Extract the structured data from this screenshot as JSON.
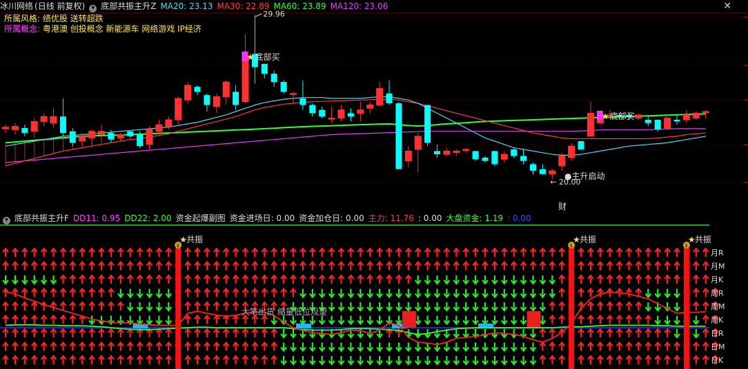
{
  "main_header": {
    "stock": "冰川网络",
    "period": "(日线 前复权)",
    "indicator": "底部共振主升Z",
    "ma": [
      {
        "label": "MA20: 23.13",
        "color": "#4fd7ee"
      },
      {
        "label": "MA30: 22.89",
        "color": "#ff3b3b"
      },
      {
        "label": "MA60: 23.89",
        "color": "#33ff33"
      },
      {
        "label": "MA120: 23.06",
        "color": "#e040ff"
      }
    ]
  },
  "info": {
    "style_label": "所属风格:",
    "style_value": "绩优股 送转超跌",
    "concept_label": "所属概念:",
    "concept_value": "粤港澳 创投概念 新能源车 网络游戏 IP经济"
  },
  "annotations": {
    "high": "29.96",
    "low": "20.00",
    "buy_label": "底部买",
    "launch_label": "●主升启动",
    "fin_label": "财",
    "resonance_label": "共振",
    "warning": "大笔出货 缩量低位观望"
  },
  "ind_header": {
    "indicator": "底部共振主升F",
    "items": [
      {
        "label": "DD11: 0.95",
        "color": "#ff40ff"
      },
      {
        "label": "DD22: 2.00",
        "color": "#33ff33"
      },
      {
        "label": "资金起爆副图",
        "color": "#dddddd"
      },
      {
        "label": "资金进场日: 0.00",
        "color": "#dddddd"
      },
      {
        "label": "资金加仓日: 0.00",
        "color": "#dddddd"
      },
      {
        "label": "主力: 11.76",
        "color": "#ff3b3b"
      },
      {
        "label": ": 0.00",
        "color": "#dddddd"
      },
      {
        "label": "大盘资金: 1.19",
        "color": "#33ff33"
      },
      {
        "label": ": 0.00",
        "color": "#3333ff"
      }
    ]
  },
  "row_labels": [
    "月R",
    "月M",
    "月K",
    "周R",
    "周M",
    "周K",
    "日R",
    "日M",
    "日K"
  ],
  "colors": {
    "up": "#ff3030",
    "down": "#00ffff",
    "ma20": "#4fd7ee",
    "ma30": "#ff3b3b",
    "ma60": "#33ff33",
    "ma120": "#e040ff",
    "arrow_up": "#ff2020",
    "arrow_down": "#22ee22"
  },
  "chart_data": {
    "type": "candlestick",
    "candles": [
      {
        "o": 23.05,
        "h": 23.3,
        "l": 22.8,
        "c": 23.15
      },
      {
        "o": 23.0,
        "h": 23.4,
        "l": 22.7,
        "c": 23.2
      },
      {
        "o": 23.1,
        "h": 23.3,
        "l": 22.6,
        "c": 22.8
      },
      {
        "o": 22.9,
        "h": 23.7,
        "l": 22.5,
        "c": 23.5
      },
      {
        "o": 23.5,
        "h": 24.0,
        "l": 23.2,
        "c": 23.8
      },
      {
        "o": 23.4,
        "h": 24.3,
        "l": 23.1,
        "c": 23.8
      },
      {
        "o": 23.8,
        "h": 24.9,
        "l": 22.6,
        "c": 22.8
      },
      {
        "o": 22.9,
        "h": 23.1,
        "l": 22.0,
        "c": 22.2
      },
      {
        "o": 22.3,
        "h": 22.8,
        "l": 22.0,
        "c": 22.6
      },
      {
        "o": 22.5,
        "h": 23.0,
        "l": 22.1,
        "c": 22.9
      },
      {
        "o": 22.7,
        "h": 23.3,
        "l": 22.3,
        "c": 22.9
      },
      {
        "o": 22.8,
        "h": 23.0,
        "l": 22.2,
        "c": 22.4
      },
      {
        "o": 22.5,
        "h": 22.8,
        "l": 22.3,
        "c": 22.7
      },
      {
        "o": 22.9,
        "h": 22.9,
        "l": 22.5,
        "c": 22.6
      },
      {
        "o": 22.7,
        "h": 22.9,
        "l": 21.9,
        "c": 22.0
      },
      {
        "o": 22.1,
        "h": 23.2,
        "l": 21.8,
        "c": 23.0
      },
      {
        "o": 22.9,
        "h": 23.6,
        "l": 22.7,
        "c": 23.3
      },
      {
        "o": 23.2,
        "h": 23.8,
        "l": 23.0,
        "c": 23.6
      },
      {
        "o": 23.6,
        "h": 25.0,
        "l": 23.3,
        "c": 24.9
      },
      {
        "o": 24.8,
        "h": 25.9,
        "l": 24.6,
        "c": 25.7
      },
      {
        "o": 25.6,
        "h": 25.7,
        "l": 25.1,
        "c": 25.3
      },
      {
        "o": 25.1,
        "h": 25.2,
        "l": 24.1,
        "c": 24.5
      },
      {
        "o": 24.4,
        "h": 25.2,
        "l": 24.0,
        "c": 25.0
      },
      {
        "o": 25.0,
        "h": 26.0,
        "l": 24.5,
        "c": 25.9
      },
      {
        "o": 25.3,
        "h": 25.7,
        "l": 24.2,
        "c": 24.5
      },
      {
        "o": 24.7,
        "h": 28.8,
        "l": 24.6,
        "c": 27.5
      },
      {
        "o": 27.6,
        "h": 29.96,
        "l": 25.8,
        "c": 26.8
      },
      {
        "o": 27.0,
        "h": 27.0,
        "l": 26.1,
        "c": 26.4
      },
      {
        "o": 26.4,
        "h": 26.6,
        "l": 25.6,
        "c": 25.9
      },
      {
        "o": 25.9,
        "h": 26.0,
        "l": 25.2,
        "c": 25.3
      },
      {
        "o": 25.2,
        "h": 25.3,
        "l": 24.6,
        "c": 25.2
      },
      {
        "o": 24.9,
        "h": 26.0,
        "l": 24.2,
        "c": 24.5
      },
      {
        "o": 24.5,
        "h": 24.6,
        "l": 23.8,
        "c": 24.0
      },
      {
        "o": 24.2,
        "h": 24.4,
        "l": 23.7,
        "c": 23.8
      },
      {
        "o": 23.7,
        "h": 24.4,
        "l": 23.4,
        "c": 23.7
      },
      {
        "o": 23.7,
        "h": 24.5,
        "l": 23.5,
        "c": 24.2
      },
      {
        "o": 24.0,
        "h": 24.3,
        "l": 23.5,
        "c": 23.8
      },
      {
        "o": 24.0,
        "h": 24.7,
        "l": 23.5,
        "c": 24.2
      },
      {
        "o": 24.3,
        "h": 24.7,
        "l": 24.0,
        "c": 24.5
      },
      {
        "o": 24.5,
        "h": 25.9,
        "l": 24.4,
        "c": 25.5
      },
      {
        "o": 25.2,
        "h": 26.0,
        "l": 24.5,
        "c": 24.6
      },
      {
        "o": 24.6,
        "h": 24.7,
        "l": 20.6,
        "c": 20.6
      },
      {
        "o": 21.1,
        "h": 22.0,
        "l": 20.7,
        "c": 21.7
      },
      {
        "o": 21.8,
        "h": 22.8,
        "l": 20.4,
        "c": 22.6
      },
      {
        "o": 24.5,
        "h": 24.5,
        "l": 22.0,
        "c": 22.2
      },
      {
        "o": 21.7,
        "h": 22.1,
        "l": 21.3,
        "c": 21.5
      },
      {
        "o": 21.5,
        "h": 21.9,
        "l": 21.4,
        "c": 21.7
      },
      {
        "o": 21.6,
        "h": 21.8,
        "l": 21.4,
        "c": 21.7
      },
      {
        "o": 21.8,
        "h": 21.9,
        "l": 21.6,
        "c": 21.8
      },
      {
        "o": 21.7,
        "h": 21.7,
        "l": 21.1,
        "c": 21.2
      },
      {
        "o": 21.3,
        "h": 21.4,
        "l": 21.0,
        "c": 21.1
      },
      {
        "o": 21.7,
        "h": 21.7,
        "l": 20.8,
        "c": 20.9
      },
      {
        "o": 21.2,
        "h": 21.7,
        "l": 21.0,
        "c": 21.5
      },
      {
        "o": 21.8,
        "h": 21.9,
        "l": 21.3,
        "c": 21.4
      },
      {
        "o": 21.4,
        "h": 21.8,
        "l": 20.9,
        "c": 21.1
      },
      {
        "o": 20.9,
        "h": 21.0,
        "l": 20.3,
        "c": 20.5
      },
      {
        "o": 20.6,
        "h": 20.9,
        "l": 20.3,
        "c": 20.3
      },
      {
        "o": 20.3,
        "h": 20.6,
        "l": 20.0,
        "c": 20.5
      },
      {
        "o": 20.8,
        "h": 21.6,
        "l": 20.5,
        "c": 21.4
      },
      {
        "o": 21.3,
        "h": 22.2,
        "l": 21.1,
        "c": 22.0
      },
      {
        "o": 22.3,
        "h": 22.3,
        "l": 21.8,
        "c": 21.8
      },
      {
        "o": 22.6,
        "h": 24.7,
        "l": 22.6,
        "c": 24.0
      },
      {
        "o": 23.4,
        "h": 24.1,
        "l": 23.3,
        "c": 23.9
      },
      {
        "o": 23.9,
        "h": 24.2,
        "l": 23.7,
        "c": 23.9
      },
      {
        "o": 23.9,
        "h": 24.0,
        "l": 23.7,
        "c": 23.8
      },
      {
        "o": 23.9,
        "h": 24.0,
        "l": 23.6,
        "c": 23.8
      },
      {
        "o": 23.7,
        "h": 23.9,
        "l": 23.6,
        "c": 23.9
      },
      {
        "o": 23.6,
        "h": 23.8,
        "l": 23.2,
        "c": 23.4
      },
      {
        "o": 23.6,
        "h": 23.6,
        "l": 22.9,
        "c": 23.0
      },
      {
        "o": 23.1,
        "h": 23.9,
        "l": 23.0,
        "c": 23.7
      },
      {
        "o": 23.6,
        "h": 23.9,
        "l": 23.3,
        "c": 23.5
      },
      {
        "o": 23.6,
        "h": 24.2,
        "l": 23.4,
        "c": 23.9
      },
      {
        "o": 23.7,
        "h": 24.1,
        "l": 23.6,
        "c": 24.0
      },
      {
        "o": 24.1,
        "h": 24.2,
        "l": 23.7,
        "c": 24.1
      }
    ],
    "ma20": [
      22.0,
      22.1,
      22.2,
      22.3,
      22.4,
      22.5,
      22.6,
      22.65,
      22.7,
      22.75,
      22.8,
      22.85,
      22.9,
      22.95,
      23.0,
      23.05,
      23.1,
      23.15,
      23.25,
      23.35,
      23.45,
      23.6,
      23.75,
      23.9,
      24.1,
      24.3,
      24.5,
      24.65,
      24.75,
      24.85,
      24.9,
      24.95,
      24.95,
      24.95,
      24.9,
      24.9,
      24.9,
      24.9,
      24.95,
      25.0,
      25.0,
      24.9,
      24.8,
      24.6,
      24.3,
      24.0,
      23.7,
      23.4,
      23.1,
      22.8,
      22.5,
      22.3,
      22.1,
      21.9,
      21.8,
      21.7,
      21.6,
      21.5,
      21.45,
      21.45,
      21.5,
      21.6,
      21.7,
      21.8,
      21.9,
      22.0,
      22.05,
      22.1,
      22.15,
      22.2,
      22.3,
      22.4,
      22.5,
      22.6
    ],
    "ma30": [
      20.8,
      20.95,
      21.1,
      21.25,
      21.4,
      21.55,
      21.7,
      21.8,
      21.9,
      22.0,
      22.1,
      22.2,
      22.3,
      22.4,
      22.45,
      22.55,
      22.65,
      22.75,
      22.9,
      23.05,
      23.2,
      23.35,
      23.5,
      23.65,
      23.8,
      24.0,
      24.2,
      24.35,
      24.45,
      24.55,
      24.6,
      24.65,
      24.7,
      24.72,
      24.74,
      24.76,
      24.78,
      24.8,
      24.82,
      24.84,
      24.85,
      24.8,
      24.7,
      24.6,
      24.45,
      24.3,
      24.15,
      24.0,
      23.85,
      23.7,
      23.55,
      23.4,
      23.25,
      23.1,
      22.95,
      22.8,
      22.7,
      22.6,
      22.5,
      22.45,
      22.45,
      22.45,
      22.45,
      22.45,
      22.45,
      22.45,
      22.45,
      22.45,
      22.5,
      22.55,
      22.6,
      22.7,
      22.75,
      22.8
    ],
    "ma60": [
      22.2,
      22.25,
      22.3,
      22.35,
      22.4,
      22.45,
      22.5,
      22.55,
      22.6,
      22.62,
      22.64,
      22.66,
      22.68,
      22.7,
      22.72,
      22.75,
      22.78,
      22.8,
      22.82,
      22.85,
      22.88,
      22.9,
      22.93,
      22.95,
      22.98,
      23.0,
      23.03,
      23.06,
      23.09,
      23.12,
      23.15,
      23.18,
      23.2,
      23.22,
      23.24,
      23.26,
      23.28,
      23.3,
      23.32,
      23.34,
      23.35,
      23.3,
      23.25,
      23.22,
      23.25,
      23.3,
      23.35,
      23.38,
      23.42,
      23.46,
      23.5,
      23.52,
      23.54,
      23.56,
      23.58,
      23.6,
      23.62,
      23.64,
      23.66,
      23.68,
      23.7,
      23.72,
      23.74,
      23.76,
      23.78,
      23.8,
      23.82,
      23.84,
      23.86,
      23.88,
      23.9,
      23.92,
      23.94,
      23.96
    ],
    "ma120": [
      21.0,
      21.05,
      21.1,
      21.15,
      21.2,
      21.25,
      21.3,
      21.35,
      21.4,
      21.45,
      21.5,
      21.55,
      21.6,
      21.65,
      21.7,
      21.75,
      21.8,
      21.85,
      21.9,
      21.95,
      22.0,
      22.05,
      22.1,
      22.15,
      22.2,
      22.25,
      22.3,
      22.35,
      22.4,
      22.45,
      22.5,
      22.55,
      22.6,
      22.65,
      22.7,
      22.72,
      22.74,
      22.76,
      22.78,
      22.8,
      22.82,
      22.84,
      22.86,
      22.88,
      22.9,
      22.9,
      22.9,
      22.9,
      22.9,
      22.9,
      22.9,
      22.9,
      22.9,
      22.9,
      22.9,
      22.9,
      22.9,
      22.9,
      22.9,
      22.9,
      22.92,
      22.95,
      22.98,
      23.0,
      23.0,
      23.0,
      23.0,
      23.0,
      23.02,
      23.04,
      23.06,
      23.06,
      23.06,
      23.06
    ],
    "buy_signals": [
      25,
      62
    ],
    "resonance": [
      18,
      59,
      71
    ],
    "arrow_rows": [
      "UUUUUUUUUUUUUUUUUUUUUUUUUUUUUUUUUUUUUUUUUUUUUUUUUUUUUUUUUUUUUUUUUUUUUUUUUU",
      "UUUUUUUUUUUUUUUUUUUUUUUUUUUUUUUUUUUUUUUUUUUUUUUUUUUUUUUUUUUUUUUUUUUUUUUUUU",
      "DDDDDDUUUUUUUUUUUUUUUUUUUUUUUUUUUUUUUUUUUUUDDDDDDDDDDDDDDDUUUUUUUUUUUUUUUU",
      "UUUUUUUUUUUUDDDDDDUUUUUUUUUUUUUDDDDDDDDDDDDDDDDDDDDDDDDDDDUUUUUUUUUDDDDUUUU",
      "UUUUUUUUUUUUUDDDDDUUUUUUUUUUUUDDDDDDDDDDDDDDDDDDDDDDDDDDDUUUUUUUUUUDDDDUUUU",
      "UUUUUUUUUDDDDDDDDDDUUUUUUUUUDDDDDDDDDDDDDDDDDDDDDDDDDDDDDUUUUUUUUUUUDDDDDUU",
      "UUUUUUUUUUUUUUUUUUUUUUUUUUUUUDDDDDDDDDDDUUDDDDDDDDDDDDDDUUUUUUUUUUUUUUDDDUU",
      "UUUUUUUUUUUUUUUUUUUUUUUUUUUUUDDDDDDDDDDDDDDDDDDDDDDDDDDDUUUUUUUUUUUUUUUUUUU",
      "UUUUUUUUUUUUUUUUUUUUUUUUUUUUUDDDDDDDDDDDDDDDDDDDDDDDDDDDUUUUUUUUUUUUUUUUUUU"
    ],
    "osc_red": [
      0.75,
      0.7,
      0.62,
      0.55,
      0.48,
      0.42,
      0.36,
      0.3,
      0.24,
      0.18,
      0.14,
      0.11,
      0.1,
      0.1,
      0.08,
      0.06,
      0.05,
      0.05,
      0.05,
      0.3,
      0.34,
      0.3,
      0.26,
      0.24,
      0.26,
      0.3,
      0.33,
      0.32,
      0.25,
      0.12,
      0.0,
      -0.06,
      -0.1,
      -0.12,
      -0.14,
      -0.1,
      -0.05,
      -0.06,
      -0.12,
      -0.05,
      0.1,
      0.05,
      -0.2,
      -0.3,
      -0.32,
      -0.35,
      -0.3,
      -0.22,
      -0.2,
      -0.18,
      -0.15,
      -0.1,
      -0.12,
      -0.14,
      -0.18,
      -0.25,
      -0.3,
      -0.22,
      -0.1,
      0.1,
      0.4,
      0.6,
      0.7,
      0.74,
      0.72,
      0.7,
      0.65,
      0.6,
      0.5,
      0.4,
      0.3,
      0.32,
      0.32,
      0.33
    ],
    "osc_green": [
      0.05,
      0.06,
      0.06,
      0.06,
      0.05,
      0.05,
      0.04,
      0.04,
      0.04,
      0.03,
      0.02,
      0.0,
      -0.02,
      -0.03,
      -0.04,
      -0.04,
      -0.03,
      -0.02,
      -0.01,
      0.0,
      0.01,
      0.01,
      0.0,
      0.0,
      0.0,
      0.0,
      0.0,
      0.0,
      0.0,
      0.0,
      -0.02,
      -0.04,
      -0.05,
      -0.05,
      -0.05,
      -0.04,
      -0.02,
      -0.02,
      -0.02,
      -0.03,
      -0.04,
      -0.06,
      -0.1,
      -0.14,
      -0.12,
      -0.08,
      -0.05,
      -0.02,
      -0.01,
      0.0,
      0.0,
      0.0,
      0.0,
      0.0,
      0.0,
      0.0,
      0.0,
      0.0,
      0.01,
      0.02,
      0.02,
      0.03,
      0.04,
      0.05,
      0.05,
      0.05,
      0.05,
      0.05,
      0.04,
      0.04,
      0.03,
      0.03,
      0.03,
      0.03
    ],
    "cyan_blocks": [
      14,
      31,
      41,
      50
    ],
    "red_blocks": [
      42,
      55
    ]
  }
}
